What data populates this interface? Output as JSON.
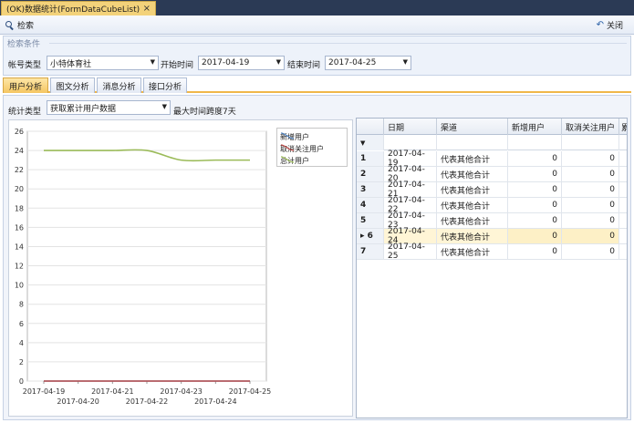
{
  "window": {
    "tab_title": "(OK)数据统计(FormDataCubeList)",
    "tab_close": "×"
  },
  "toolbar": {
    "search_label": "检索",
    "close_label": "关闭"
  },
  "query": {
    "group_title": "检索条件",
    "account_type_label": "帐号类型",
    "account_type_value": "小特体育社",
    "start_time_label": "开始时间",
    "start_time_value": "2017-04-19",
    "end_time_label": "结束时间",
    "end_time_value": "2017-04-25"
  },
  "tabs": [
    {
      "label": "用户分析",
      "active": true
    },
    {
      "label": "图文分析",
      "active": false
    },
    {
      "label": "消息分析",
      "active": false
    },
    {
      "label": "接口分析",
      "active": false
    }
  ],
  "filter": {
    "stat_type_label": "统计类型",
    "stat_type_value": "获取累计用户数据",
    "max_span_note": "最大时间跨度7天"
  },
  "chart_data": {
    "type": "line",
    "x": [
      "2017-04-19",
      "2017-04-20",
      "2017-04-21",
      "2017-04-22",
      "2017-04-23",
      "2017-04-24",
      "2017-04-25"
    ],
    "series": [
      {
        "name": "新增用户",
        "color": "#4f81bd",
        "values": [
          0,
          0,
          0,
          0,
          0,
          0,
          0
        ]
      },
      {
        "name": "取消关注用户",
        "color": "#c0504d",
        "values": [
          0,
          0,
          0,
          0,
          0,
          0,
          0
        ]
      },
      {
        "name": "总计用户",
        "color": "#9bbb59",
        "values": [
          24,
          24,
          24,
          24,
          23,
          23,
          23
        ]
      }
    ],
    "ylim": [
      0,
      26
    ],
    "yticks": [
      0,
      2,
      4,
      6,
      8,
      10,
      12,
      14,
      16,
      18,
      20,
      22,
      24,
      26
    ],
    "grid": "horizontal",
    "legend": "top-right"
  },
  "grid": {
    "columns": [
      "日期",
      "渠道",
      "新增用户",
      "取消关注用户",
      "累"
    ],
    "filter_glyph": "▼",
    "focused_marker": "▸",
    "rows": [
      {
        "index": "1",
        "date": "2017-04-19",
        "channel": "代表其他合计",
        "new_users": "0",
        "unsub_users": "0"
      },
      {
        "index": "2",
        "date": "2017-04-20",
        "channel": "代表其他合计",
        "new_users": "0",
        "unsub_users": "0"
      },
      {
        "index": "3",
        "date": "2017-04-21",
        "channel": "代表其他合计",
        "new_users": "0",
        "unsub_users": "0"
      },
      {
        "index": "4",
        "date": "2017-04-22",
        "channel": "代表其他合计",
        "new_users": "0",
        "unsub_users": "0"
      },
      {
        "index": "5",
        "date": "2017-04-23",
        "channel": "代表其他合计",
        "new_users": "0",
        "unsub_users": "0"
      },
      {
        "index": "6",
        "date": "2017-04-24",
        "channel": "代表其他合计",
        "new_users": "0",
        "unsub_users": "0",
        "focused": true
      },
      {
        "index": "7",
        "date": "2017-04-25",
        "channel": "代表其他合计",
        "new_users": "0",
        "unsub_users": "0"
      }
    ]
  }
}
